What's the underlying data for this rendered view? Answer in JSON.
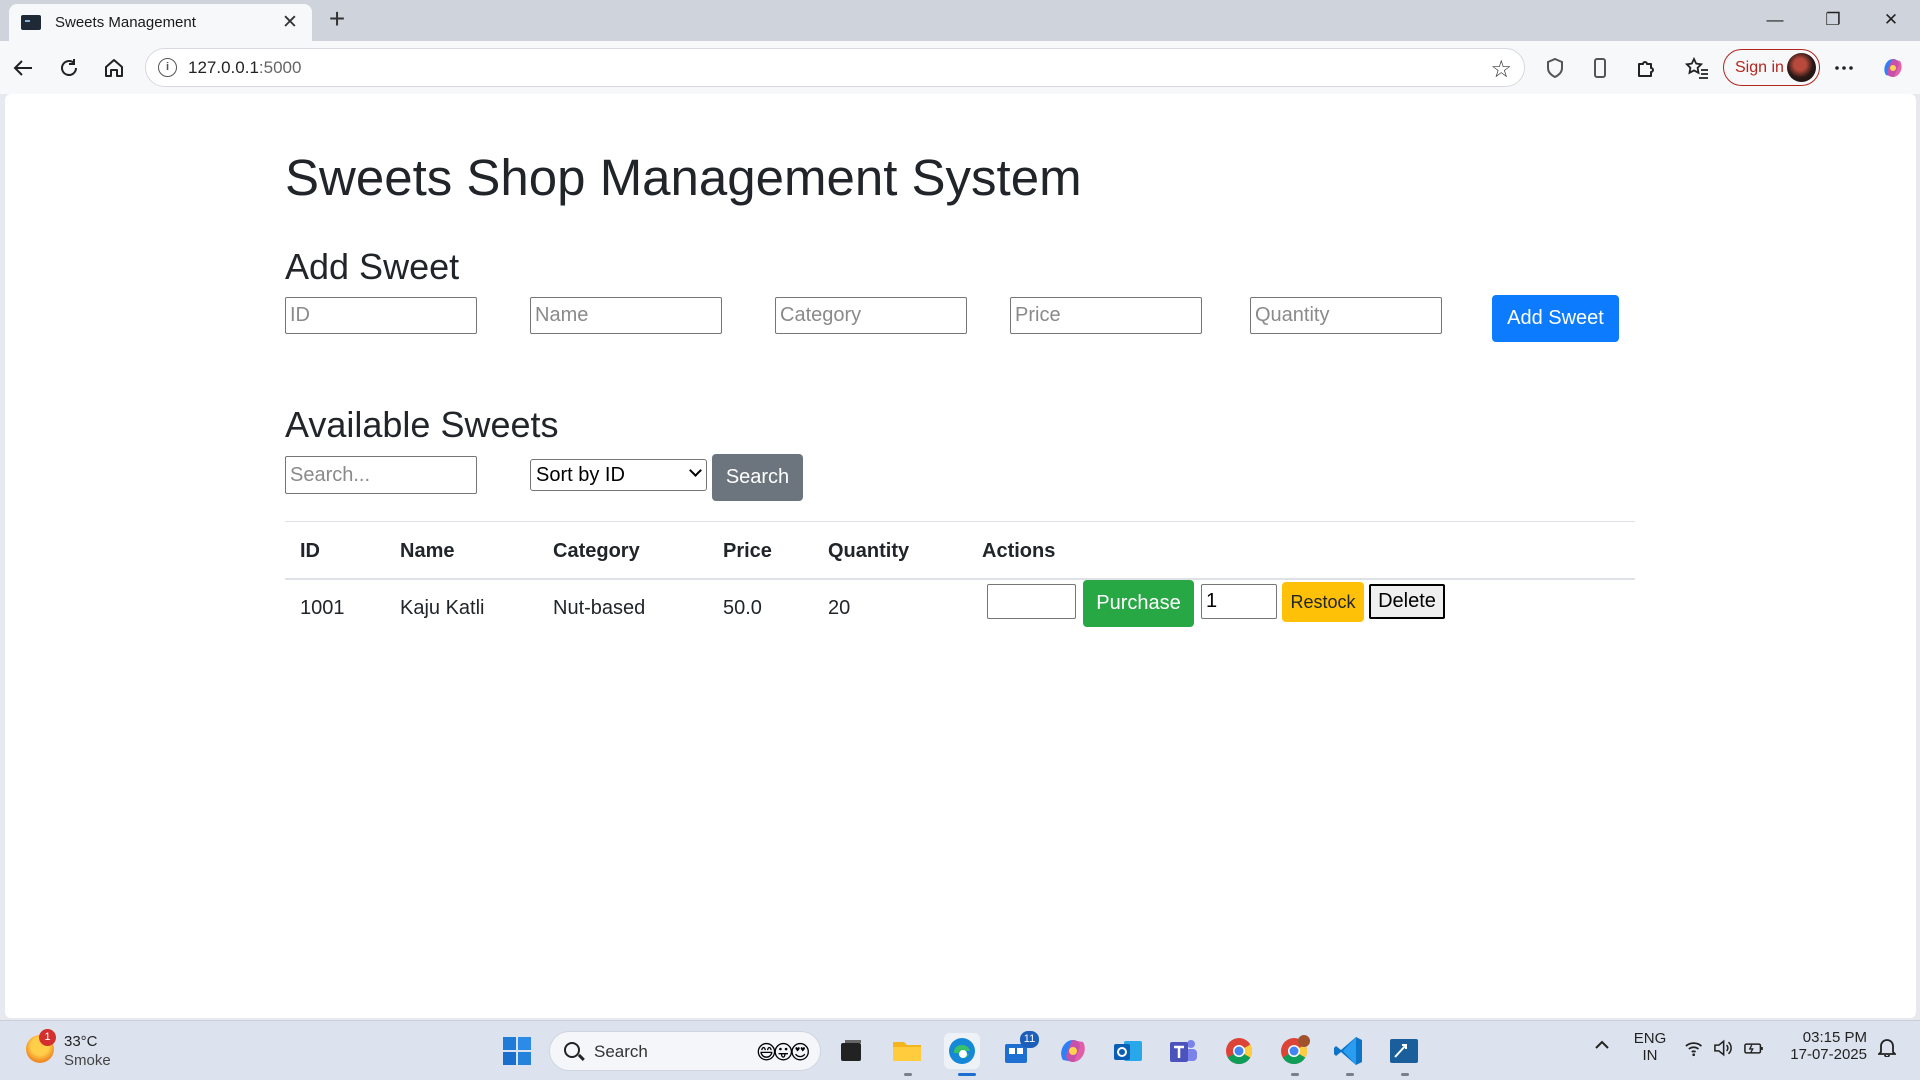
{
  "browser": {
    "tab_title": "Sweets Management",
    "new_tab": "+",
    "url_host": "127.0.0.1",
    "url_port": ":5000",
    "sign_in": "Sign in",
    "controls": {
      "minimize": "—",
      "restore": "❐",
      "close": "✕",
      "tab_close": "✕"
    }
  },
  "page": {
    "title": "Sweets Shop Management System",
    "add_heading": "Add Sweet",
    "add_form": {
      "id_placeholder": "ID",
      "name_placeholder": "Name",
      "category_placeholder": "Category",
      "price_placeholder": "Price",
      "quantity_placeholder": "Quantity",
      "submit": "Add Sweet"
    },
    "available_heading": "Available Sweets",
    "search_placeholder": "Search...",
    "sort_selected": "Sort by ID",
    "search_button": "Search",
    "table": {
      "headers": [
        "ID",
        "Name",
        "Category",
        "Price",
        "Quantity",
        "Actions"
      ],
      "rows": [
        {
          "id": "1001",
          "name": "Kaju Katli",
          "category": "Nut-based",
          "price": "50.0",
          "quantity": "20",
          "purchase_qty": "",
          "purchase_label": "Purchase",
          "restock_qty": "1",
          "restock_label": "Restock",
          "delete_label": "Delete"
        }
      ]
    }
  },
  "taskbar": {
    "weather_temp": "33°C",
    "weather_cond": "Smoke",
    "weather_badge": "1",
    "search_label": "Search",
    "search_emoji": "😄😛😍",
    "lang_top": "ENG",
    "lang_bottom": "IN",
    "time": "03:15 PM",
    "date": "17-07-2025",
    "store_badge": "11"
  },
  "colors": {
    "primary": "#0d7bfd",
    "secondary": "#6c757d",
    "success": "#28a745",
    "warning": "#ffc107",
    "signin": "#b3261e"
  }
}
